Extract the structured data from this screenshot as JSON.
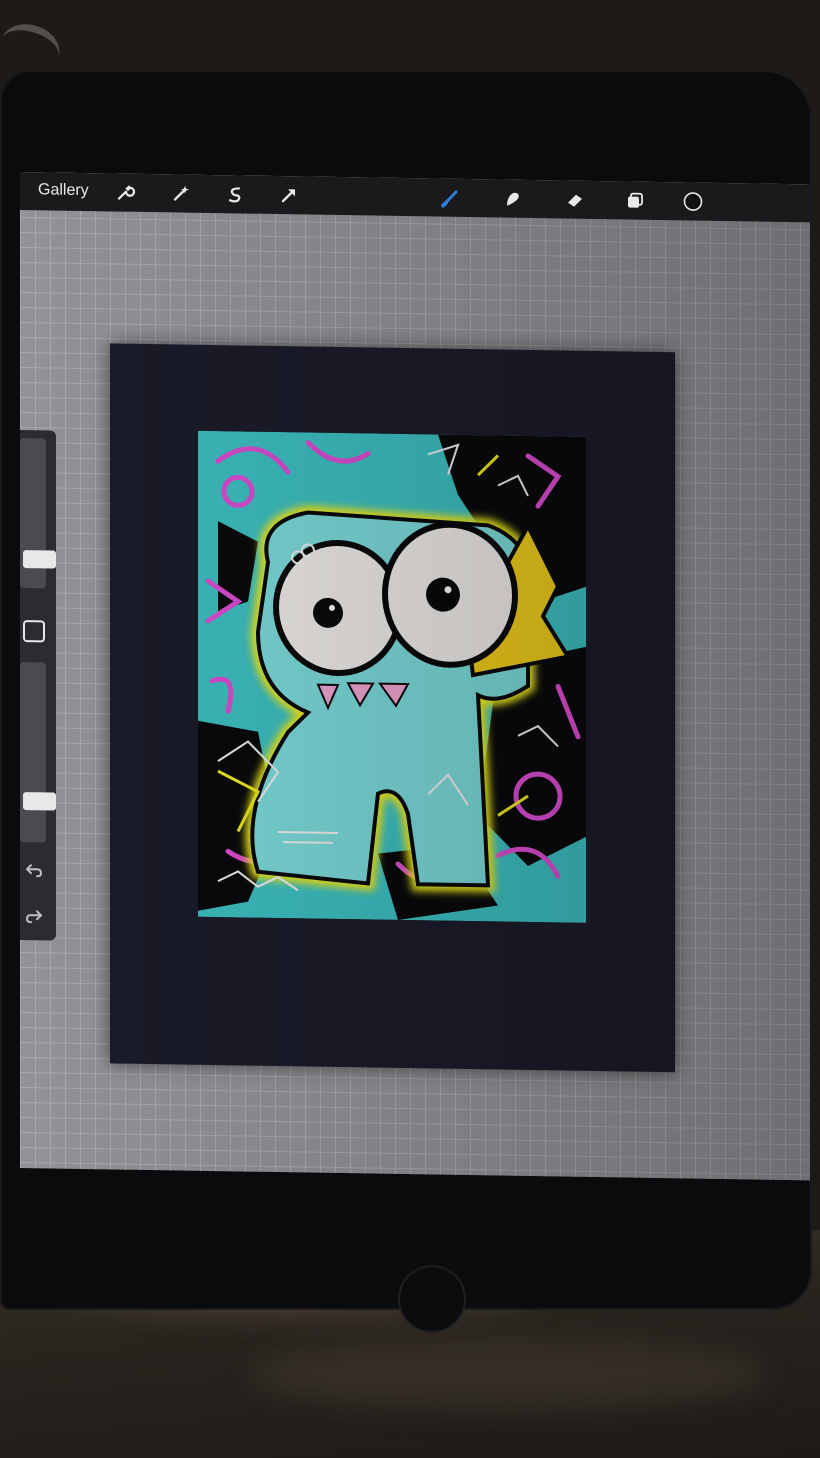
{
  "app": {
    "gallery_label": "Gallery"
  },
  "toolbar": {
    "left_icons": [
      "wrench-icon",
      "magic-wand-icon",
      "selection-icon",
      "transform-arrow-icon"
    ],
    "right_icons": [
      "brush-icon",
      "smudge-icon",
      "eraser-icon",
      "layers-icon",
      "color-circle-icon"
    ],
    "active_tool": "brush",
    "accent_color": "#2f7bd8",
    "current_color": "#111111"
  },
  "sidebar": {
    "brush_size_level": 0.15,
    "opacity_level": 0.2,
    "icons": [
      "modify-square-icon",
      "undo-icon",
      "redo-icon"
    ]
  },
  "artwork": {
    "colors": {
      "background": "#3fc5c7",
      "character": "#7fe0e0",
      "outline_glow": "#f2ef1c",
      "doodles": "#e24fd8",
      "ink": "#0a0a0c",
      "eyes": "#f4f1ee",
      "beak": "#f6d21b",
      "teeth": "#f5a9d6"
    }
  }
}
